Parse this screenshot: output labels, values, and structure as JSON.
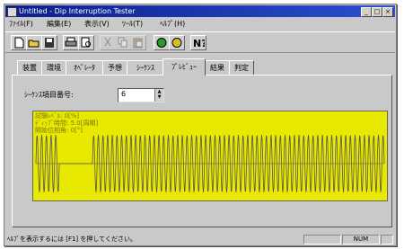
{
  "window": {
    "title": "Untitled - Dip Interruption Tester"
  },
  "title_buttons": {
    "minimize": "_",
    "maximize": "□",
    "close": "×"
  },
  "menu": [
    "ﾌｧｲﾙ(F)",
    "編集(E)",
    "表示(V)",
    "ﾂｰﾙ(T)",
    "ﾍﾙﾌﾟ(H)"
  ],
  "toolbar_icons": [
    "new-file-icon",
    "open-folder-icon",
    "save-icon",
    "print-icon",
    "print-preview-icon",
    "cut-icon",
    "copy-icon",
    "paste-icon",
    "run-icon",
    "stop-icon",
    "help-icon"
  ],
  "tabs": [
    "装置",
    "環境",
    "ｵﾍﾟﾚｰﾀ",
    "予想",
    "ｼｰｹﾝｽ",
    "ﾌﾟﾚﾋﾞｭｰ",
    "結果",
    "判定"
  ],
  "active_tab": "ﾌﾟﾚﾋﾞｭｰ",
  "sequence_field": {
    "label": "ｼｰｹﾝｽ項目番号:",
    "value": "6"
  },
  "preview": {
    "info_lines": [
      "試験ﾚﾍﾞﾙ: 0[%]",
      "ﾃﾞｨｯﾌﾟ時間: 5.0[周期]",
      "開始位相角: 0[°]"
    ],
    "background": "#e8e800",
    "trace_color": "#555555"
  },
  "status": {
    "message": "ﾍﾙﾌﾟを表示するには [F1] を押してください。",
    "num": "NUM"
  }
}
